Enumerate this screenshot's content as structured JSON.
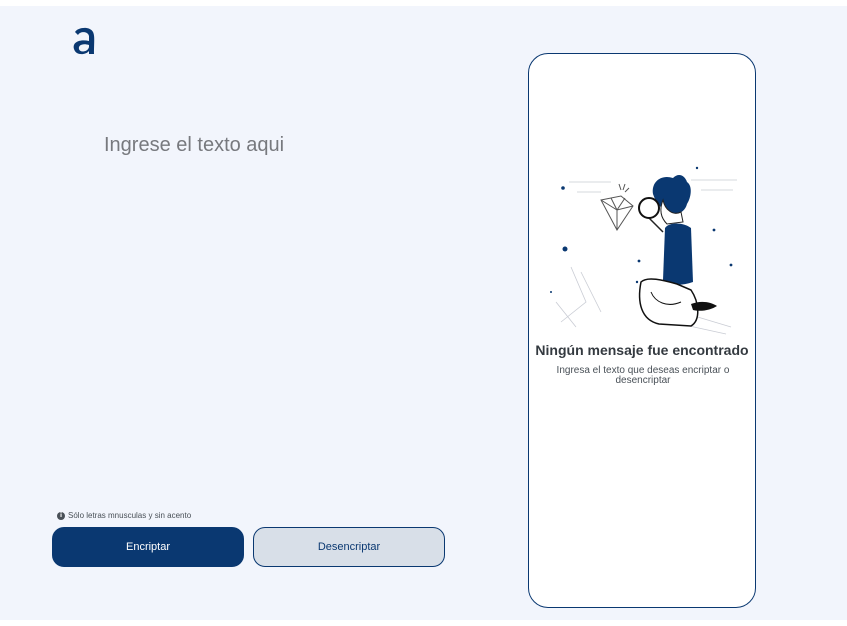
{
  "brand": {
    "logo_icon": "alura-logo-icon",
    "color": "#0a3871"
  },
  "editor": {
    "placeholder": "Ingrese el texto aqui"
  },
  "hint": {
    "icon": "info-icon",
    "text": "Sólo letras mnusculas y sin acento"
  },
  "buttons": {
    "encrypt_label": "Encriptar",
    "decrypt_label": "Desencriptar"
  },
  "result": {
    "illustration": "person-with-magnifying-glass-illustration",
    "title": "Ningún mensaje fue encontrado",
    "description": "Ingresa el texto que deseas encriptar o desencriptar"
  },
  "colors": {
    "background": "#f2f5fc",
    "primary": "#0a3871",
    "secondary_button": "#d8dfe8"
  }
}
